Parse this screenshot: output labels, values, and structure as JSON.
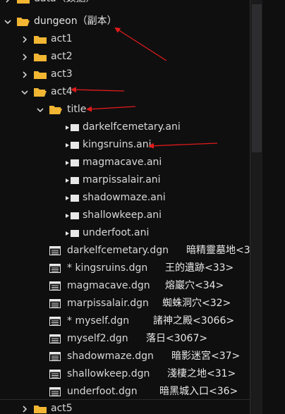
{
  "tree": {
    "partial_top": "data（数据）",
    "dungeon": "dungeon（副本）",
    "act1": "act1",
    "act2": "act2",
    "act3": "act3",
    "act4": "act4",
    "title": "title",
    "ani_files": [
      "darkelfcemetary.ani",
      "kingsruins.ani",
      "magmacave.ani",
      "marpissalair.ani",
      "shadowmaze.ani",
      "shallowkeep.ani",
      "underfoot.ani"
    ],
    "dgn_files": [
      {
        "name": "darkelfcemetary.dgn",
        "cn": "暗精靈墓地<3"
      },
      {
        "name": "* kingsruins.dgn",
        "cn": "王的遺跡<33>"
      },
      {
        "name": "magmacave.dgn",
        "cn": "熔巖穴<34>"
      },
      {
        "name": "marpissalair.dgn",
        "cn": "蜘蛛洞穴<32>"
      },
      {
        "name": "* myself.dgn",
        "cn": "諸神之殿<3066>"
      },
      {
        "name": "myself2.dgn",
        "cn": "落日<3067>"
      },
      {
        "name": "shadowmaze.dgn",
        "cn": "暗影迷宮<37>"
      },
      {
        "name": "shallowkeep.dgn",
        "cn": "淺棲之地<31>"
      },
      {
        "name": "underfoot.dgn",
        "cn": "暗黑城入口<36>"
      }
    ],
    "act5": "act5"
  },
  "colors": {
    "background": "#0f0f10",
    "folder": "#f2b632",
    "annotation_arrow": "#e21b1b",
    "text": "#d8d8d8"
  },
  "icons": {
    "expanded": "chevron-down-icon",
    "collapsed": "chevron-right-icon",
    "folder": "folder-icon",
    "animation_file": "animation-file-icon",
    "map_file": "map-file-icon"
  }
}
